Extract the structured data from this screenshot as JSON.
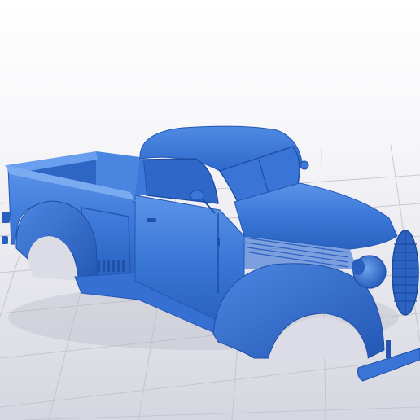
{
  "scene": {
    "subject": "pickup-truck-body-3d-model",
    "colors": {
      "background_top": "#ffffff",
      "background_bottom": "#dcdce6",
      "grid_line": "#bcbcc8",
      "model_base": "#3c78d8",
      "model_light": "#5a90e6",
      "model_dark": "#1f55b0",
      "model_shadow": "#143f8a"
    }
  }
}
